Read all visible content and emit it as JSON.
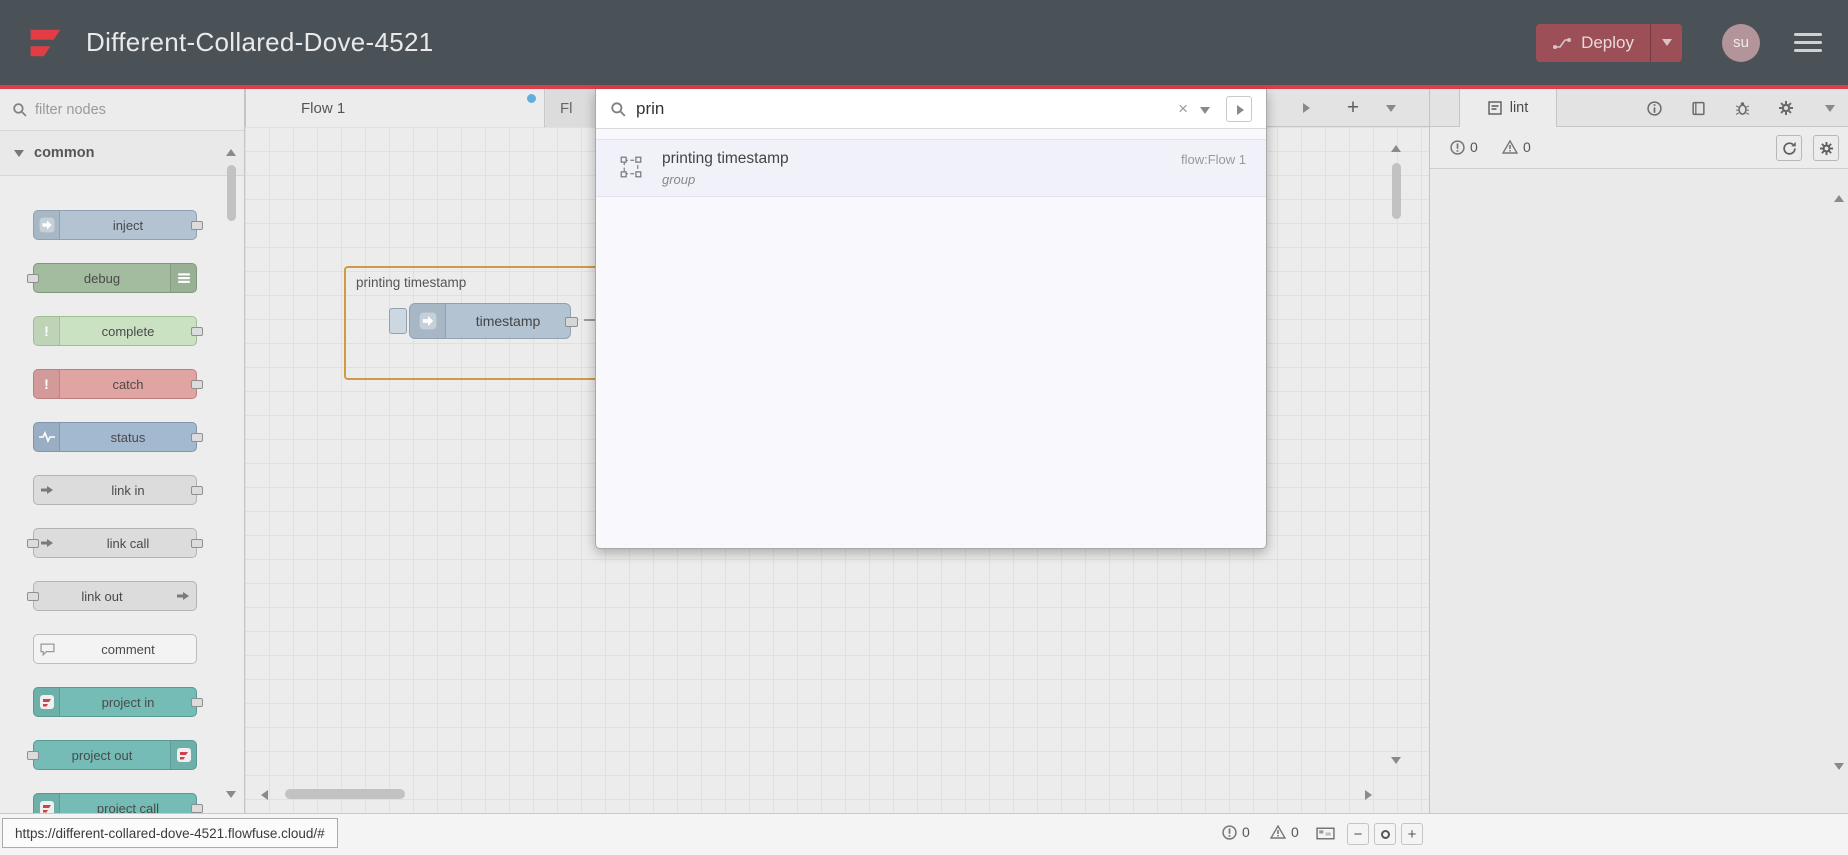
{
  "header": {
    "title": "Different-Collared-Dove-4521",
    "deploy_label": "Deploy",
    "avatar_initials": "su"
  },
  "palette": {
    "filter_placeholder": "filter nodes",
    "category_label": "common",
    "items": [
      {
        "label": "inject"
      },
      {
        "label": "debug"
      },
      {
        "label": "complete"
      },
      {
        "label": "catch"
      },
      {
        "label": "status"
      },
      {
        "label": "link in"
      },
      {
        "label": "link call"
      },
      {
        "label": "link out"
      },
      {
        "label": "comment"
      },
      {
        "label": "project in"
      },
      {
        "label": "project out"
      },
      {
        "label": "project call"
      }
    ]
  },
  "workspace": {
    "tabs": [
      {
        "label": "Flow 1"
      },
      {
        "label": "Fl"
      }
    ]
  },
  "search": {
    "value": "prin",
    "result": {
      "title": "printing timestamp",
      "type_label": "group",
      "flow_label": "flow:Flow 1"
    }
  },
  "canvas": {
    "group_label": "printing timestamp",
    "node_label": "timestamp"
  },
  "sidebar": {
    "tab_label": "lint",
    "error_count": "0",
    "warning_count": "0"
  },
  "footer": {
    "url": "https://different-collared-dove-4521.flowfuse.cloud/#",
    "error_count": "0",
    "warning_count": "0"
  },
  "glyphs": {
    "clear": "×",
    "plus": "+",
    "zoom_out": "−",
    "zoom_in": "+",
    "exclamation": "!"
  },
  "colors": {
    "accent_red": "#dd3e4b",
    "deploy_red": "#9c4f57",
    "brand_red": "#e23d45",
    "unsaved_dot_blue": "#63aede"
  }
}
